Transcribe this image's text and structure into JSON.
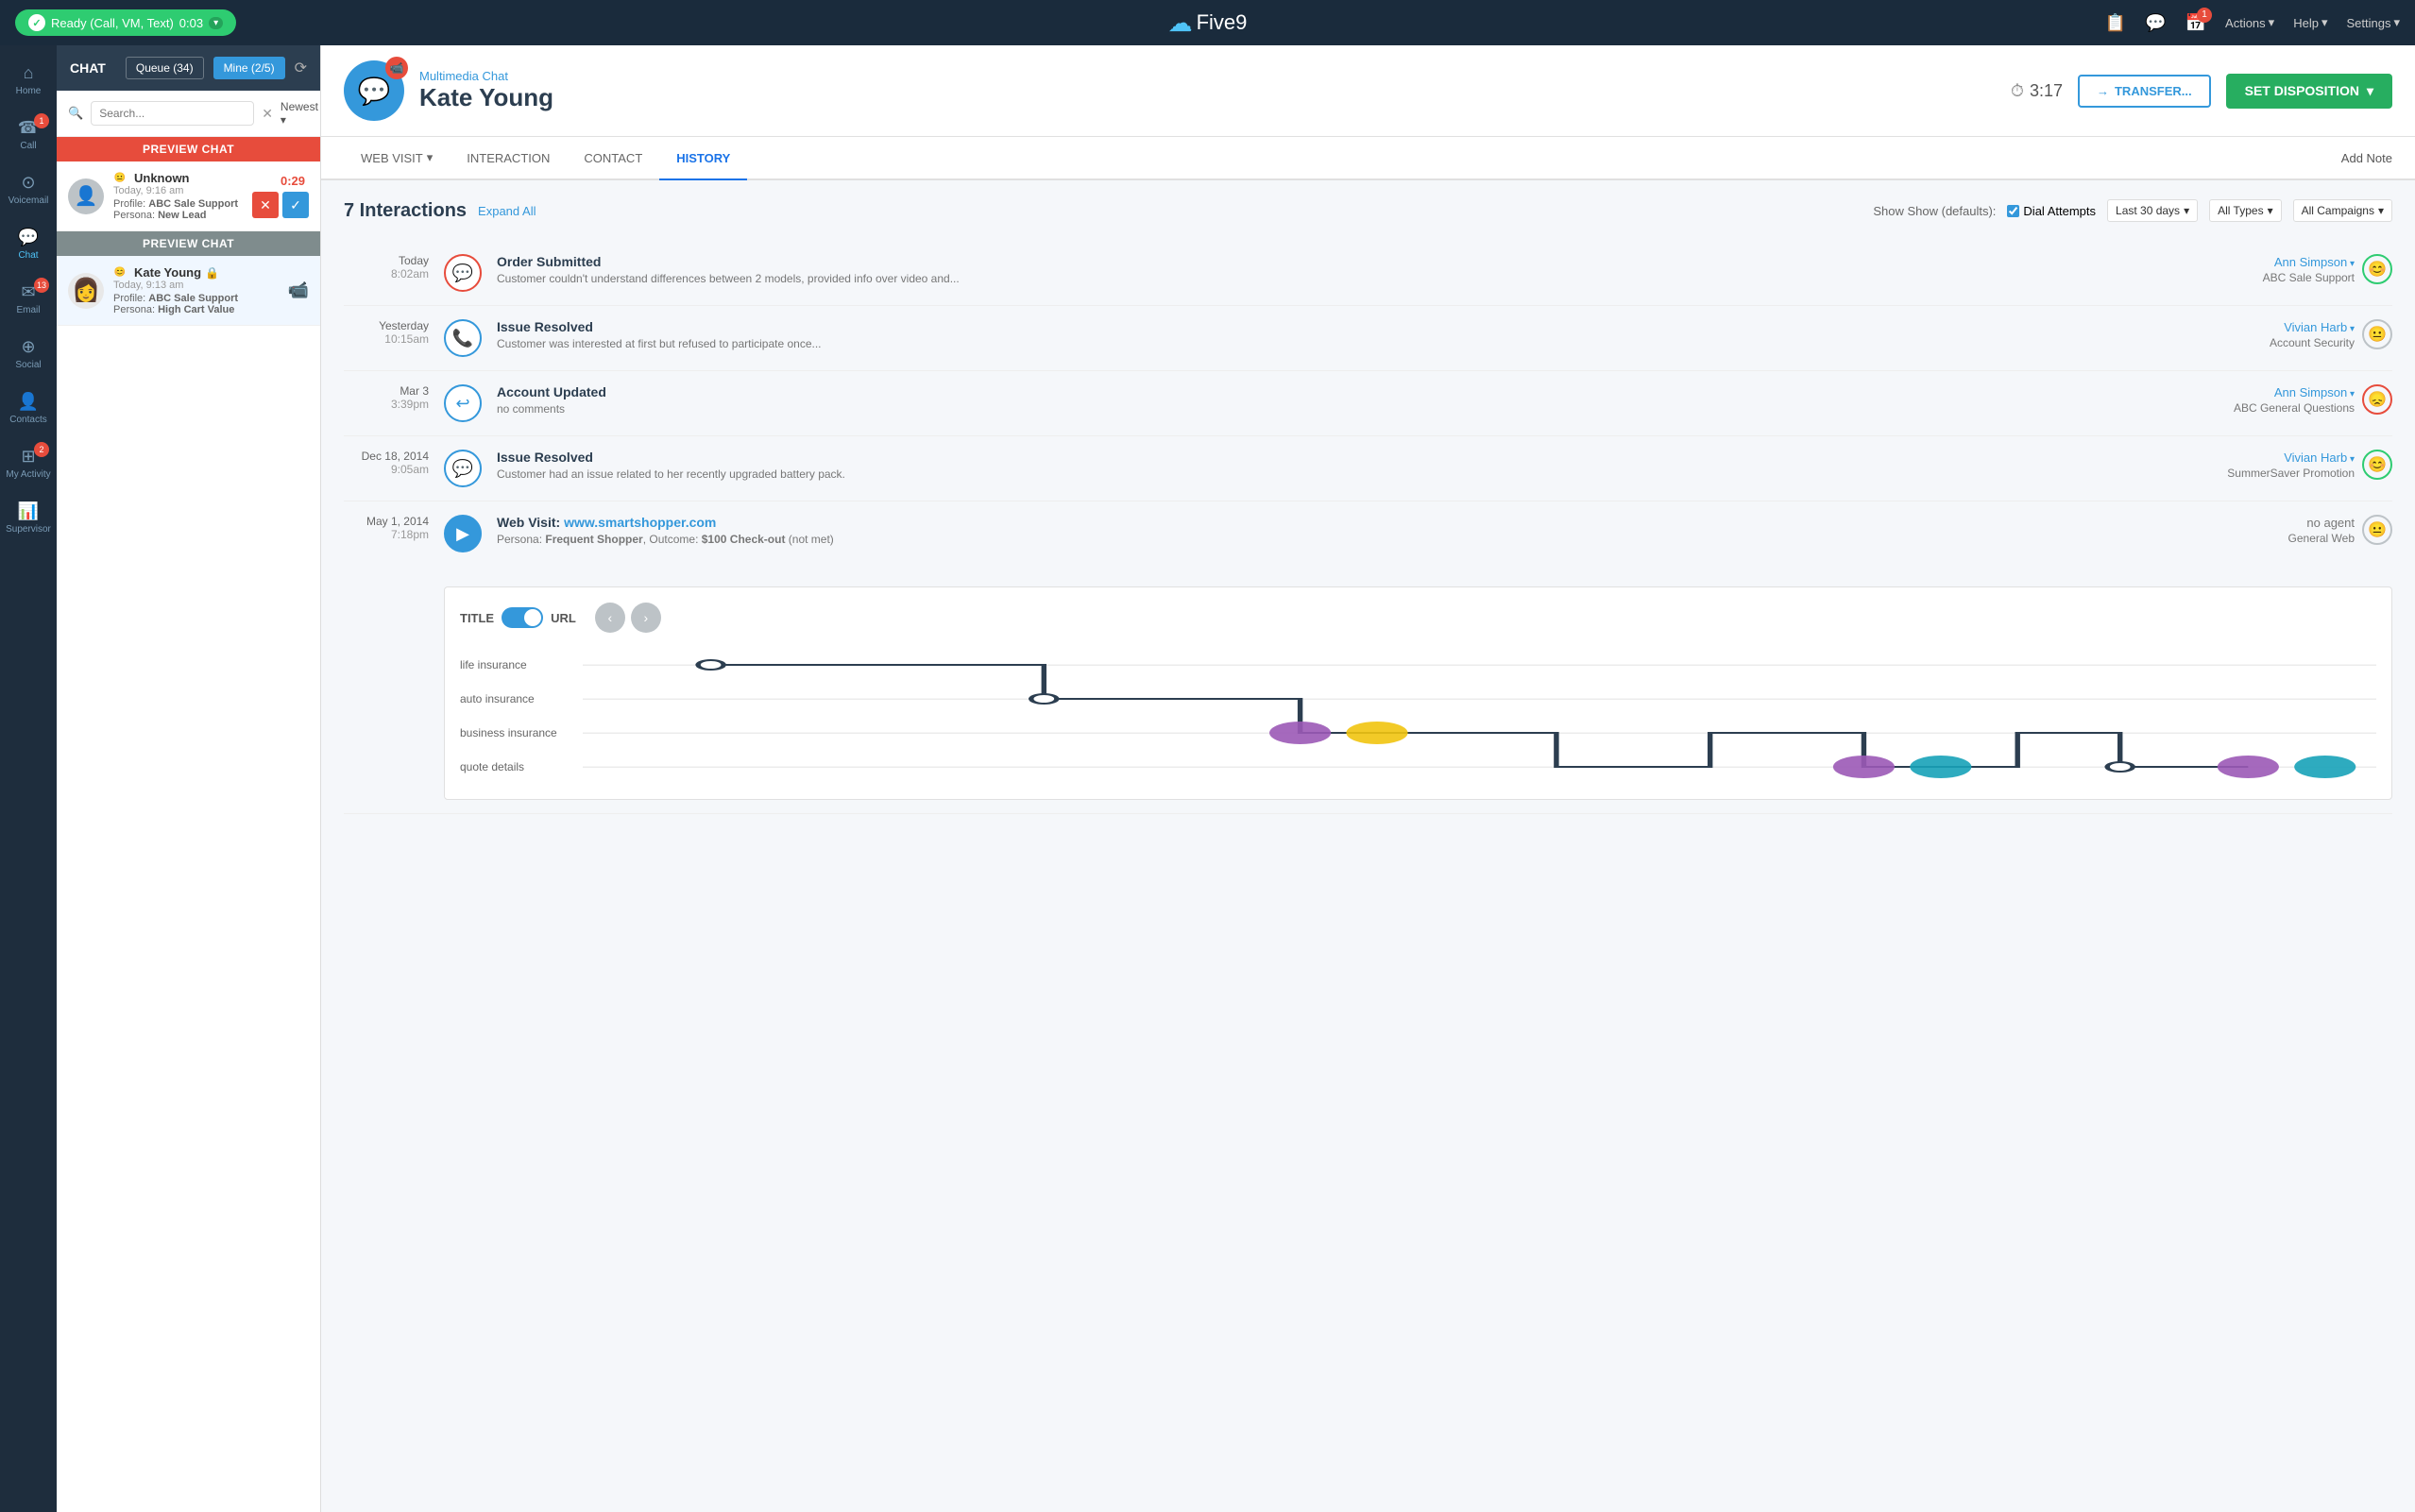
{
  "topbar": {
    "ready_label": "Ready (Call, VM, Text)",
    "timer": "0:03",
    "logo_text": "Five9",
    "actions_label": "Actions",
    "help_label": "Help",
    "settings_label": "Settings",
    "notification_count": "1"
  },
  "left_nav": {
    "items": [
      {
        "id": "home",
        "label": "Home",
        "icon": "⌂",
        "badge": null
      },
      {
        "id": "call",
        "label": "Call",
        "icon": "☎",
        "badge": "1"
      },
      {
        "id": "voicemail",
        "label": "Voicemail",
        "icon": "✉",
        "badge": null
      },
      {
        "id": "chat",
        "label": "Chat",
        "icon": "💬",
        "badge": null
      },
      {
        "id": "email",
        "label": "Email",
        "icon": "📧",
        "badge": "13"
      },
      {
        "id": "social",
        "label": "Social",
        "icon": "🌐",
        "badge": null
      },
      {
        "id": "contacts",
        "label": "Contacts",
        "icon": "👤",
        "badge": null
      },
      {
        "id": "my_activity",
        "label": "My Activity",
        "icon": "📊",
        "badge": "2"
      },
      {
        "id": "supervisor",
        "label": "Supervisor",
        "icon": "📈",
        "badge": null
      }
    ]
  },
  "chat_panel": {
    "title": "CHAT",
    "queue_btn": "Queue (34)",
    "mine_btn": "Mine (2/5)",
    "search_placeholder": "Search...",
    "sort_label": "Newest",
    "preview_chat_label1": "PREVIEW CHAT",
    "preview_chat_label2": "PREVIEW CHAT",
    "chat_items": [
      {
        "name": "Unknown",
        "time": "Today, 9:16 am",
        "profile": "ABC Sale Support",
        "persona": "New Lead",
        "timer": "0:29",
        "has_timer": true,
        "sentiment": "neutral"
      },
      {
        "name": "Kate Young",
        "time": "Today, 9:13 am",
        "profile": "ABC Sale Support",
        "persona": "High Cart Value",
        "has_video": true,
        "sentiment": "happy",
        "active": true
      }
    ]
  },
  "chat_header": {
    "subtitle": "Multimedia Chat",
    "title": "Kate Young",
    "timer": "3:17",
    "transfer_btn": "TRANSFER...",
    "set_disposition_btn": "SET DISPOSITION"
  },
  "tabs": {
    "items": [
      {
        "id": "web_visit",
        "label": "WEB VISIT",
        "has_dropdown": true
      },
      {
        "id": "interaction",
        "label": "INTERACTION"
      },
      {
        "id": "contact",
        "label": "CONTACT"
      },
      {
        "id": "history",
        "label": "HISTORY",
        "active": true
      }
    ],
    "add_note_label": "Add Note"
  },
  "history": {
    "count": "7 Interactions",
    "expand_all": "Expand All",
    "show_label": "Show (defaults):",
    "dial_attempts_label": "Dial Attempts",
    "last_30_days_label": "Last 30 days",
    "all_types_label": "All Types",
    "all_campaigns_label": "All Campaigns",
    "interactions": [
      {
        "date": "Today",
        "time": "8:02am",
        "title": "Order Submitted",
        "desc": "Customer couldn't understand differences between 2 models, provided info over video and...",
        "agent": "Ann Simpson",
        "campaign": "ABC Sale Support",
        "sentiment": "happy",
        "icon": "💬",
        "icon_color": "#e74c3c"
      },
      {
        "date": "Yesterday",
        "time": "10:15am",
        "title": "Issue Resolved",
        "desc": "Customer was interested at first but refused to participate once...",
        "agent": "Vivian Harb",
        "campaign": "Account Security",
        "sentiment": "neutral",
        "icon": "📞",
        "icon_color": "#3498db"
      },
      {
        "date": "Mar 3",
        "time": "3:39pm",
        "title": "Account Updated",
        "desc": "no comments",
        "agent": "Ann Simpson",
        "campaign": "ABC General Questions",
        "sentiment": "sad",
        "icon": "🔄",
        "icon_color": "#3498db"
      },
      {
        "date": "Dec 18, 2014",
        "time": "9:05am",
        "title": "Issue Resolved",
        "desc": "Customer had an issue related to her recently upgraded battery pack.",
        "agent": "Vivian Harb",
        "campaign": "SummerSaver Promotion",
        "sentiment": "happy",
        "icon": "💬",
        "icon_color": "#3498db"
      },
      {
        "date": "May 1, 2014",
        "time": "7:18pm",
        "title": "Web Visit:",
        "title_link": "www.smartshopper.com",
        "desc_persona": "Frequent Shopper",
        "desc_outcome": "$100 Check-out",
        "desc_met": "(not met)",
        "agent": "no agent",
        "campaign": "General Web",
        "sentiment": "neutral",
        "icon": "▶",
        "icon_color": "#3498db",
        "has_journey": true
      }
    ],
    "journey": {
      "toggle_title_label": "TITLE",
      "toggle_url_label": "URL",
      "rows": [
        {
          "label": "life insurance"
        },
        {
          "label": "auto insurance"
        },
        {
          "label": "business insurance"
        },
        {
          "label": "quote details"
        }
      ]
    }
  }
}
